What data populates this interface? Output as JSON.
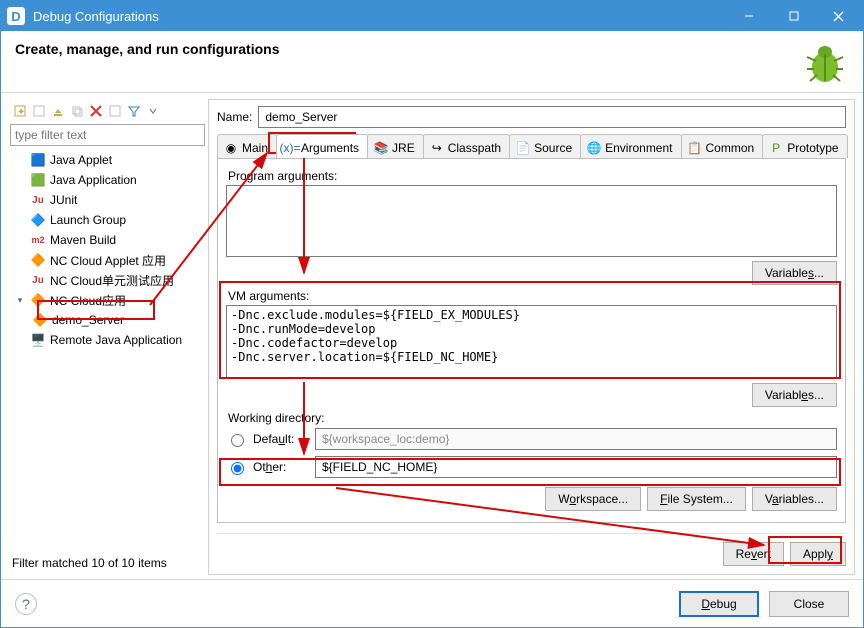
{
  "window": {
    "title": "Debug Configurations"
  },
  "header": {
    "title": "Create, manage, and run configurations"
  },
  "filter": {
    "placeholder": "type filter text"
  },
  "tree": {
    "items": [
      {
        "label": "Java Applet"
      },
      {
        "label": "Java Application"
      },
      {
        "label": "JUnit"
      },
      {
        "label": "Launch Group"
      },
      {
        "label": "Maven Build"
      },
      {
        "label": "NC Cloud Applet 应用"
      },
      {
        "label": "NC Cloud单元测试应用"
      },
      {
        "label": "NC Cloud应用",
        "expanded": true,
        "child": "demo_Server"
      },
      {
        "label": "Remote Java Application"
      }
    ]
  },
  "status": "Filter matched 10 of 10 items",
  "name": {
    "label": "Name:",
    "value": "demo_Server"
  },
  "tabs": {
    "main": "Main",
    "arguments": "Arguments",
    "jre": "JRE",
    "classpath": "Classpath",
    "source": "Source",
    "environment": "Environment",
    "common": "Common",
    "prototype": "Prototype"
  },
  "args": {
    "program_label": "Program arguments:",
    "program_value": "",
    "vm_label": "VM arguments:",
    "vm_value": "-Dnc.exclude.modules=${FIELD_EX_MODULES}\n-Dnc.runMode=develop\n-Dnc.codefactor=develop\n-Dnc.server.location=${FIELD_NC_HOME}",
    "variables_btn": "Variables..."
  },
  "wd": {
    "title": "Working directory:",
    "default_label": "Default:",
    "default_value": "${workspace_loc:demo}",
    "other_label": "Other:",
    "other_value": "${FIELD_NC_HOME}",
    "workspace_btn": "Workspace...",
    "filesystem_btn": "File System...",
    "variables_btn": "Variables..."
  },
  "rightbtns": {
    "revert": "Revert",
    "apply": "Apply"
  },
  "footer": {
    "debug": "Debug",
    "close": "Close"
  }
}
